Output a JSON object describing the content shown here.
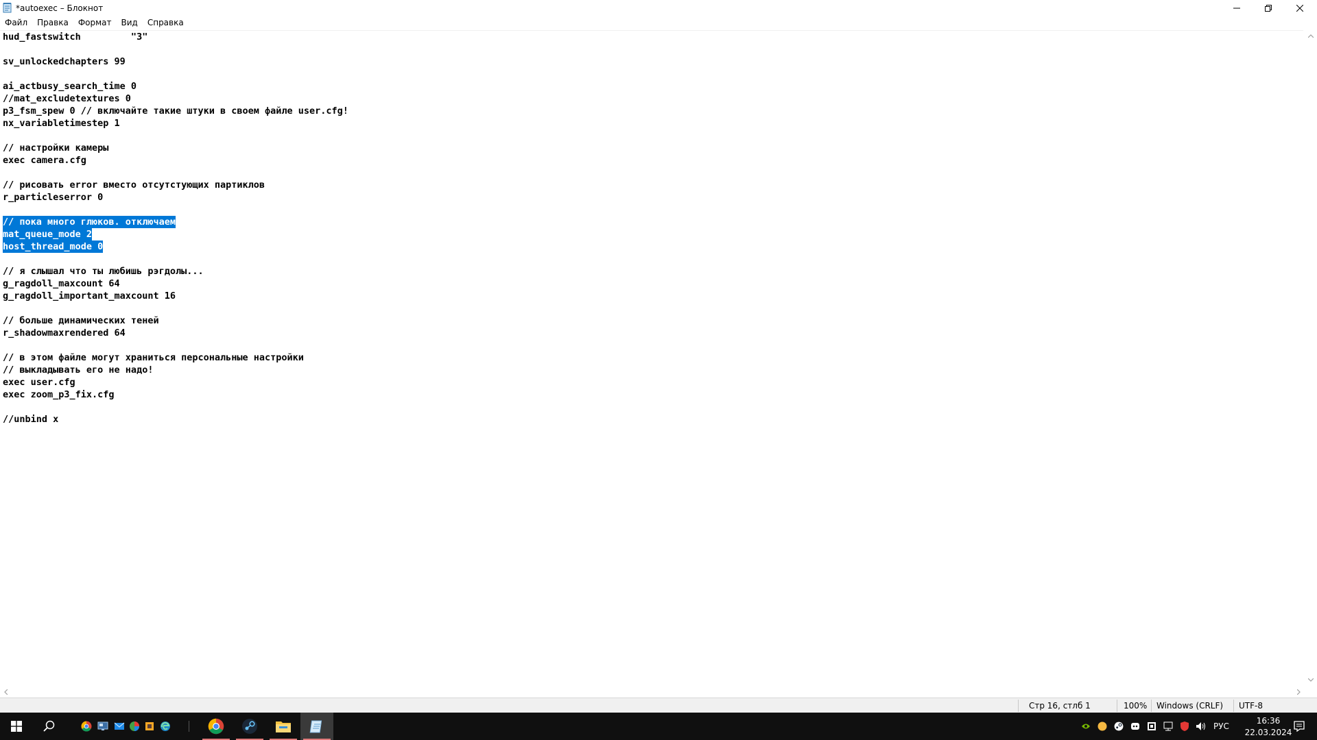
{
  "window": {
    "title": "*autoexec – Блокнот"
  },
  "menu": [
    {
      "label": "Файл"
    },
    {
      "label": "Правка"
    },
    {
      "label": "Формат"
    },
    {
      "label": "Вид"
    },
    {
      "label": "Справка"
    }
  ],
  "editor": {
    "lines": [
      {
        "text": "hud_fastswitch         \"3\"",
        "selected": false
      },
      {
        "text": "",
        "selected": false
      },
      {
        "text": "sv_unlockedchapters 99",
        "selected": false
      },
      {
        "text": "",
        "selected": false
      },
      {
        "text": "ai_actbusy_search_time 0",
        "selected": false
      },
      {
        "text": "//mat_excludetextures 0",
        "selected": false
      },
      {
        "text": "p3_fsm_spew 0 // включайте такие штуки в своем файле user.cfg!",
        "selected": false
      },
      {
        "text": "nx_variabletimestep 1",
        "selected": false
      },
      {
        "text": "",
        "selected": false
      },
      {
        "text": "// настройки камеры",
        "selected": false
      },
      {
        "text": "exec camera.cfg",
        "selected": false
      },
      {
        "text": "",
        "selected": false
      },
      {
        "text": "// рисовать error вместо отсутстующих партиклов",
        "selected": false
      },
      {
        "text": "r_particleserror 0",
        "selected": false
      },
      {
        "text": "",
        "selected": false
      },
      {
        "text": "// пока много глюков. отключаем",
        "selected": true
      },
      {
        "text": "mat_queue_mode 2",
        "selected": true
      },
      {
        "text": "host_thread_mode 0",
        "selected": true
      },
      {
        "text": "",
        "selected": false
      },
      {
        "text": "// я слышал что ты любишь рэгдолы...",
        "selected": false
      },
      {
        "text": "g_ragdoll_maxcount 64",
        "selected": false
      },
      {
        "text": "g_ragdoll_important_maxcount 16",
        "selected": false
      },
      {
        "text": "",
        "selected": false
      },
      {
        "text": "// больше динамических теней",
        "selected": false
      },
      {
        "text": "r_shadowmaxrendered 64",
        "selected": false
      },
      {
        "text": "",
        "selected": false
      },
      {
        "text": "// в этом файле могут храниться персональные настройки",
        "selected": false
      },
      {
        "text": "// выкладывать его не надо!",
        "selected": false
      },
      {
        "text": "exec user.cfg",
        "selected": false
      },
      {
        "text": "exec zoom_p3_fix.cfg",
        "selected": false
      },
      {
        "text": "",
        "selected": false
      },
      {
        "text": "//unbind x",
        "selected": false
      }
    ],
    "selection_color": "#0078d7"
  },
  "status": {
    "position": "Стр 16, стлб 1",
    "zoom": "100%",
    "line_endings": "Windows (CRLF)",
    "encoding": "UTF-8"
  },
  "taskbar": {
    "language": "РУС",
    "time": "16:36",
    "date": "22.03.2024",
    "icons": [
      "windows-start-icon",
      "search-icon",
      "chrome-icon",
      "steam-icon",
      "file-explorer-icon",
      "notepad-icon"
    ]
  }
}
